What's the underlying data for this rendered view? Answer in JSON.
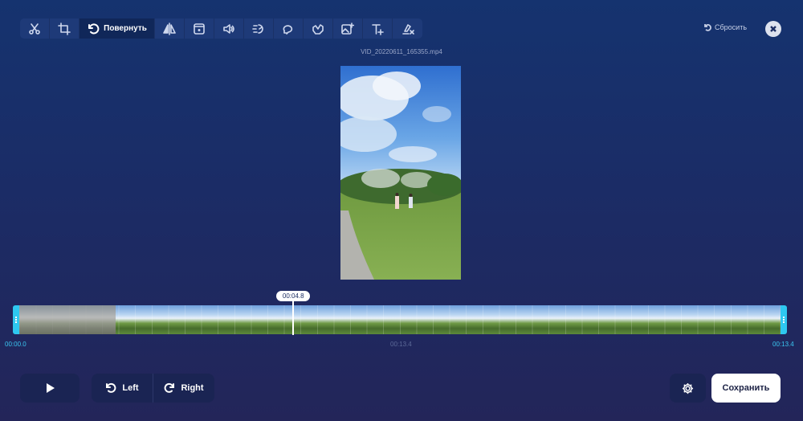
{
  "toolbar": {
    "tools": [
      {
        "name": "scissors-icon"
      },
      {
        "name": "crop-icon"
      },
      {
        "name": "rotate-icon",
        "label": "Повернуть",
        "active": true
      },
      {
        "name": "flip-icon"
      },
      {
        "name": "frame-icon"
      },
      {
        "name": "volume-icon"
      },
      {
        "name": "speed-icon"
      },
      {
        "name": "loop-icon"
      },
      {
        "name": "stabilize-icon"
      },
      {
        "name": "add-image-icon"
      },
      {
        "name": "add-text-icon"
      },
      {
        "name": "remove-logo-icon"
      }
    ]
  },
  "header": {
    "reset_label": "Сбросить",
    "filename": "VID_20220611_165355.mp4"
  },
  "timeline": {
    "playhead_time": "00:04.8",
    "start_time": "00:00.0",
    "mid_time": "00:13.4",
    "end_time": "00:13.4",
    "playhead_fraction": 0.36
  },
  "controls": {
    "rotate_left_label": "Left",
    "rotate_right_label": "Right",
    "save_label": "Сохранить"
  },
  "colors": {
    "accent": "#2ec8f0",
    "background": "#1b2c66"
  }
}
